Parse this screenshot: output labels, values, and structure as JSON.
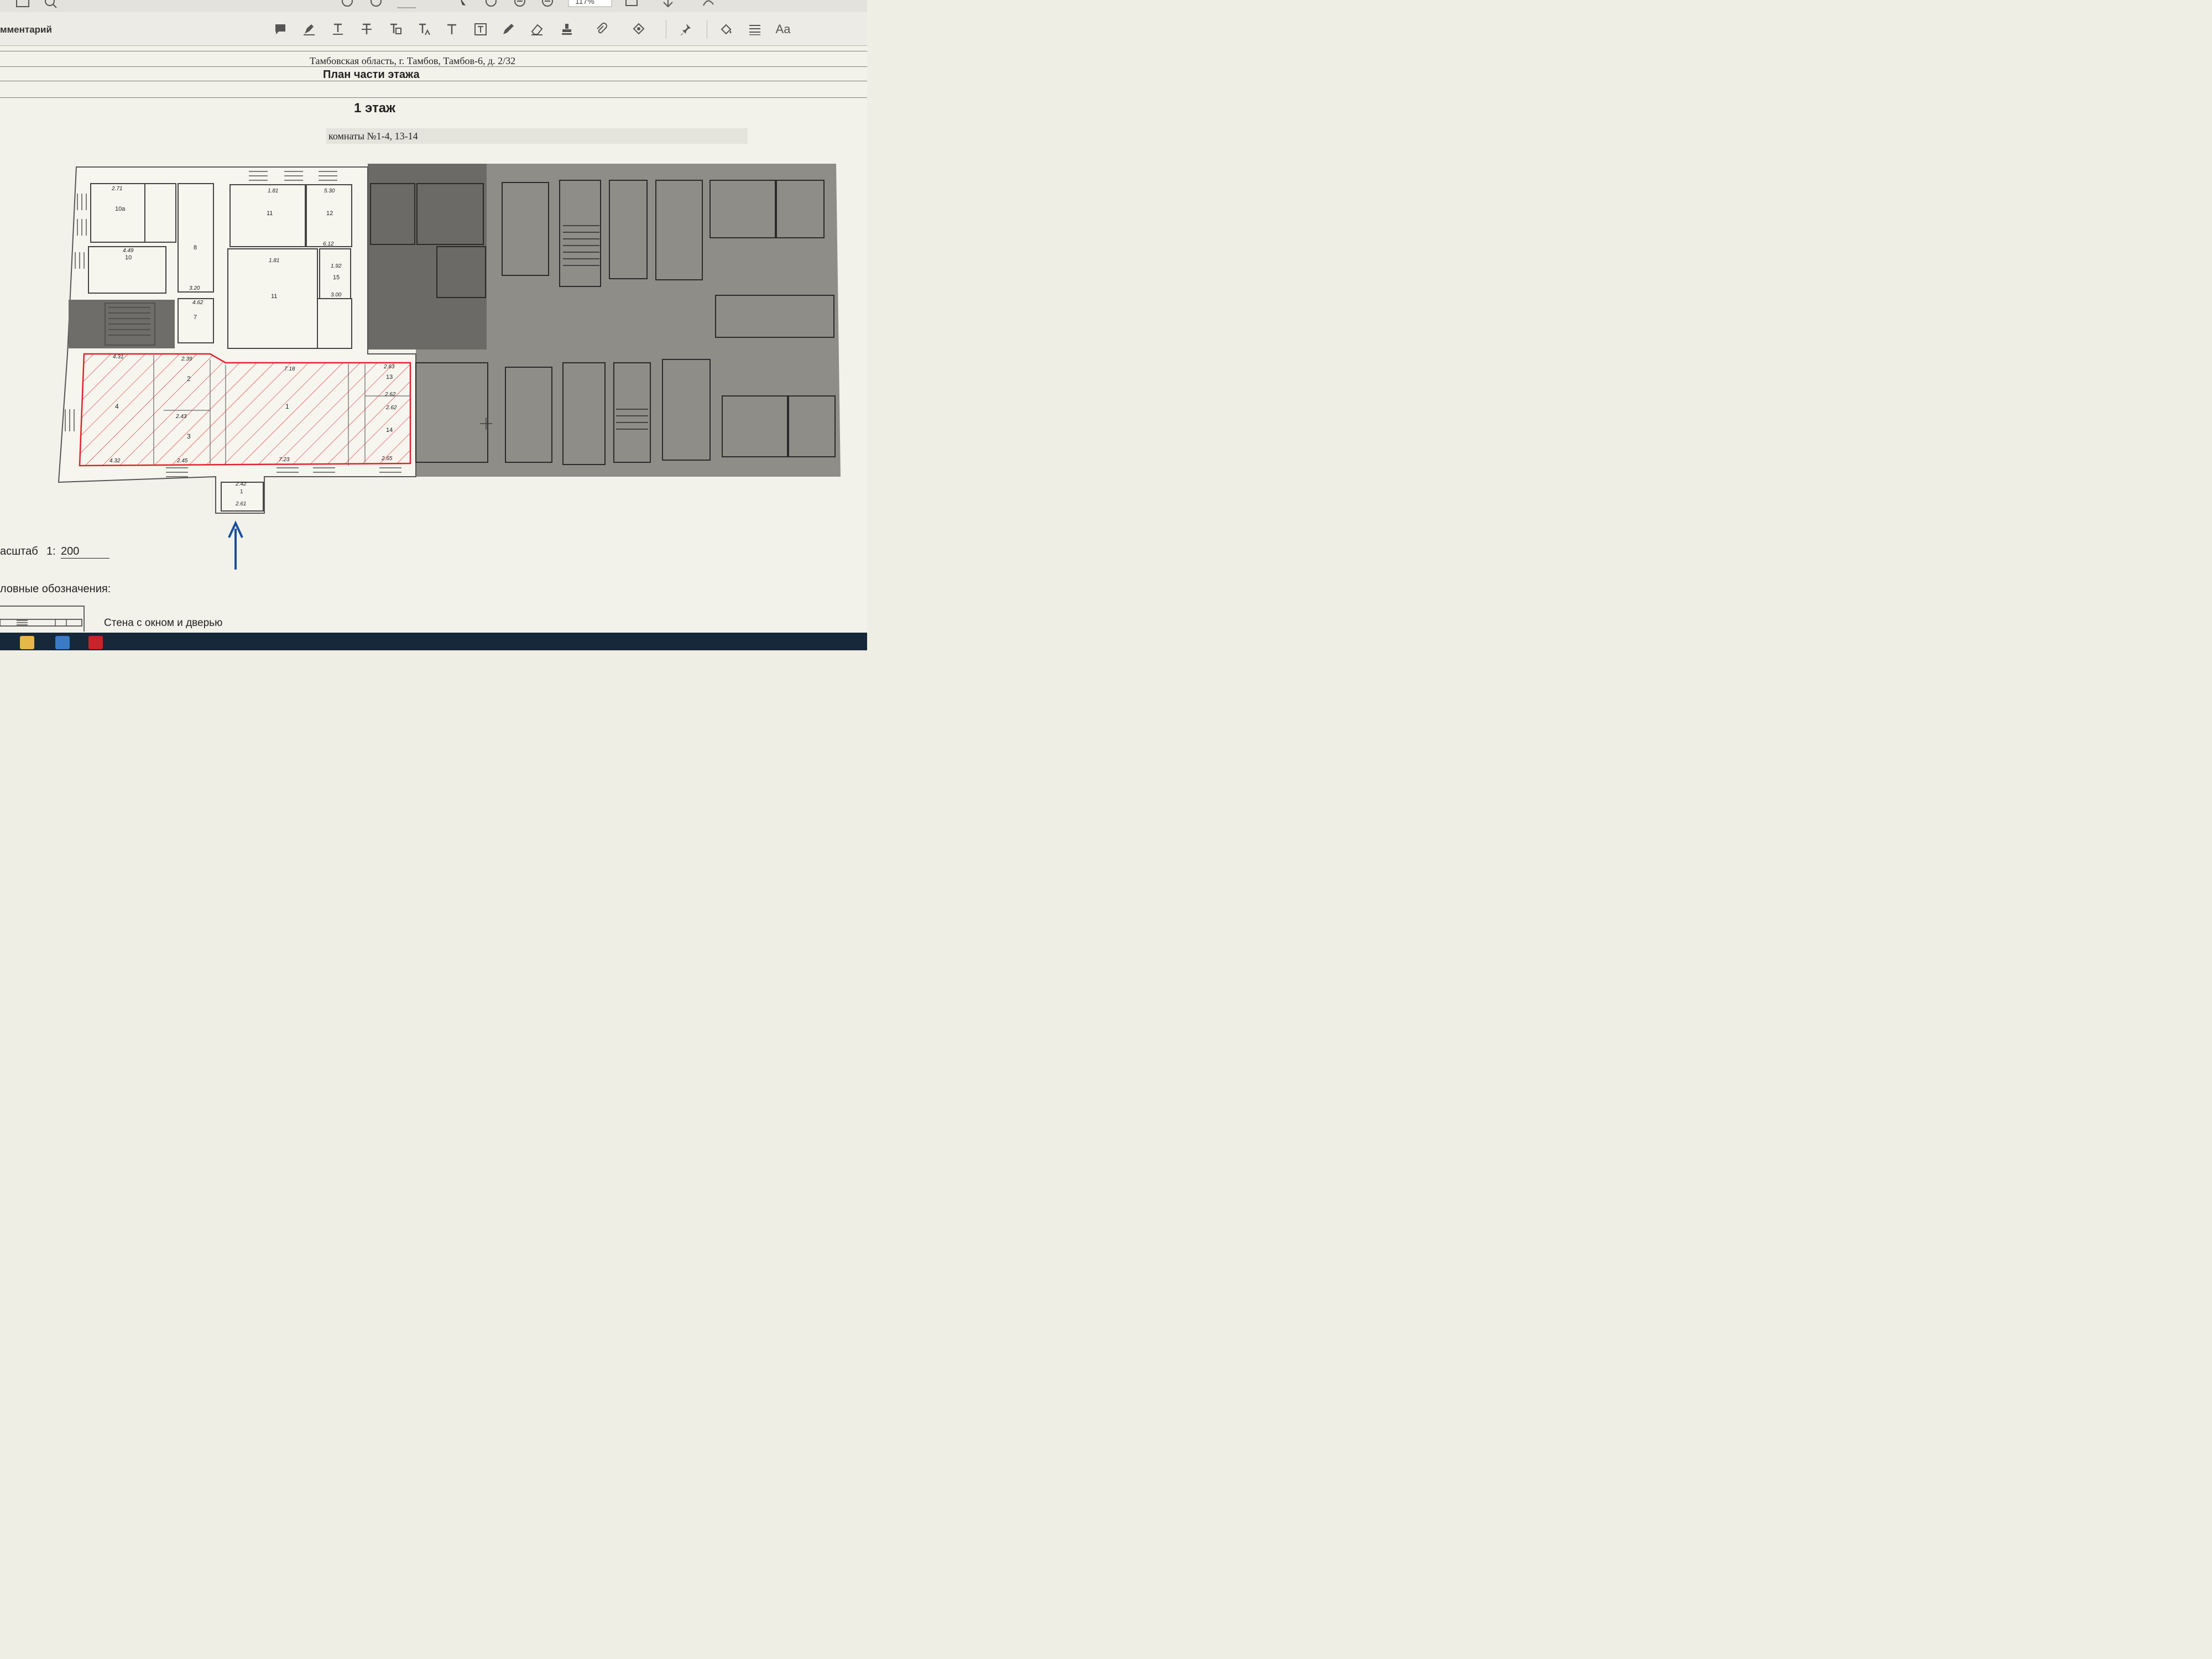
{
  "toolbar": {
    "zoom": "117%",
    "comment_panel_label": "мментарий",
    "tools": [
      "sticky-note-icon",
      "highlight-icon",
      "underline-text-icon",
      "strikethrough-icon",
      "replace-text-icon",
      "insert-text-icon",
      "add-text-icon",
      "text-box-icon",
      "pencil-icon",
      "eraser-icon",
      "stamp-icon",
      "attach-file-icon",
      "shapes-icon",
      "pin-icon",
      "fill-color-icon",
      "line-style-icon",
      "font-size-icon"
    ],
    "font_tool_label": "Aa"
  },
  "document": {
    "address": "Тамбовская область, г. Тамбов, Тамбов-6, д. 2/32",
    "title": "План части этажа",
    "floor": "1 этаж",
    "rooms": "комнаты №1-4, 13-14",
    "scale_label": "асштаб",
    "scale_ratio": "1:",
    "scale_value": "200",
    "legend_heading": "ловные обозначения:",
    "legend_wall": "Стена с окном и дверью"
  },
  "plan": {
    "highlight_color": "#e0202a",
    "arrow_color": "#1a4fa0",
    "rooms_left": [
      {
        "n": "1",
        "d": [
          "7.18",
          "5.42",
          "7.23"
        ]
      },
      {
        "n": "2",
        "d": [
          "3.40",
          "2.39"
        ]
      },
      {
        "n": "3",
        "d": [
          "2.43",
          "3.15",
          "2.45"
        ]
      },
      {
        "n": "4",
        "d": [
          "4.31",
          "4.66",
          "4.32"
        ]
      },
      {
        "n": "13",
        "d": [
          "2.63",
          "2.07",
          "2.62"
        ]
      },
      {
        "n": "14",
        "d": [
          "2.62",
          "3.60",
          "2.65"
        ]
      },
      {
        "n": "5",
        "d": [
          "1.98",
          "2.62",
          "2.01"
        ]
      },
      {
        "n": "6",
        "d": [
          "2.04",
          "5.75"
        ]
      },
      {
        "n": "7",
        "d": [
          "4.62",
          "1.76"
        ]
      },
      {
        "n": "8",
        "d": [
          "3.20",
          "3.61",
          "3.25"
        ]
      },
      {
        "n": "10",
        "d": [
          "4.49",
          "3.96"
        ]
      },
      {
        "n": "10а",
        "d": [
          "2.71",
          "2.75"
        ]
      },
      {
        "n": "11",
        "d": [
          "1.81",
          "1.63"
        ]
      },
      {
        "n": "12",
        "d": [
          "5.30",
          "6.12",
          "5.31"
        ]
      },
      {
        "n": "15",
        "d": [
          "1.92",
          "3.00",
          "1.93"
        ]
      }
    ],
    "entrance": {
      "n": "1",
      "d": [
        "2.42",
        "2.61",
        "1.57",
        "1.59"
      ]
    }
  },
  "taskbar": {
    "apps": [
      "file-explorer-icon",
      "remote-desktop-icon",
      "pdf-reader-icon"
    ]
  }
}
